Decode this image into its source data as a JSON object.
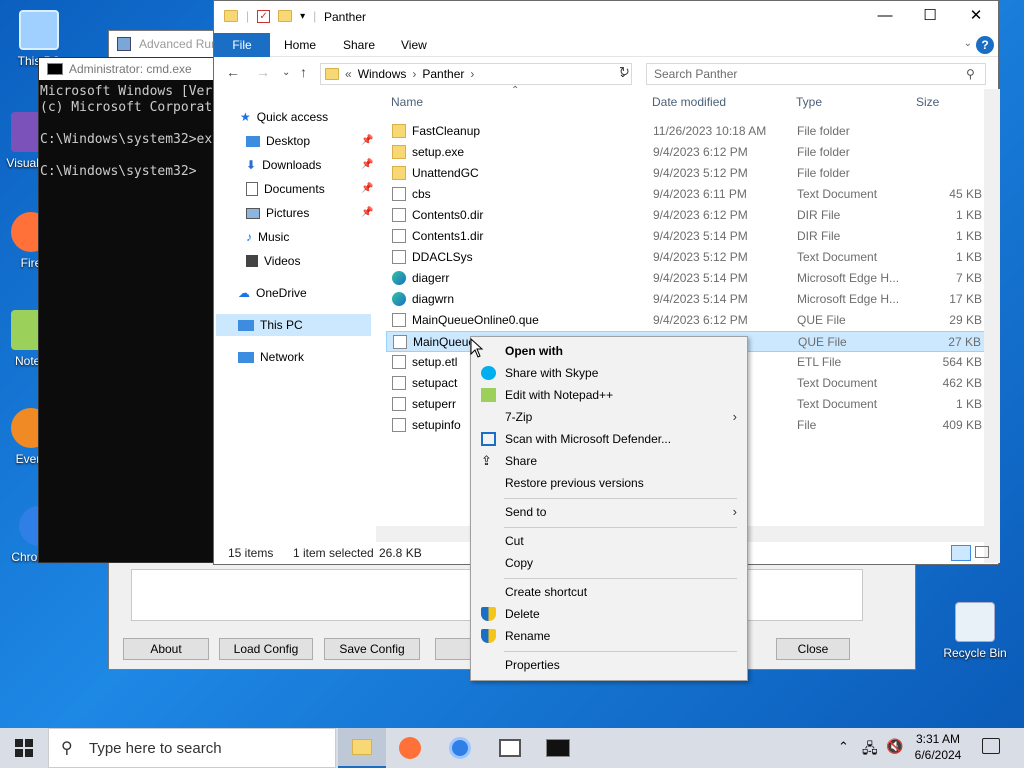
{
  "desktop": {
    "icons": [
      {
        "label": "This PC"
      },
      {
        "label": "Visual 20"
      },
      {
        "label": "Fire"
      },
      {
        "label": "Notep"
      },
      {
        "label": "Every"
      },
      {
        "label": "Chromium"
      }
    ],
    "recycle_bin": "Recycle Bin"
  },
  "advanced_run": {
    "title": "Advanced Run",
    "buttons": {
      "about": "About",
      "load": "Load Config",
      "save": "Save Config",
      "close": "Close"
    }
  },
  "cmd": {
    "title": "Administrator: cmd.exe",
    "lines": [
      "Microsoft Windows [Ver",
      "(c) Microsoft Corporat",
      "",
      "C:\\Windows\\system32>ex",
      "",
      "C:\\Windows\\system32>"
    ]
  },
  "explorer": {
    "title": "Panther",
    "ribbon": {
      "file": "File",
      "home": "Home",
      "share": "Share",
      "view": "View"
    },
    "address": {
      "prefix": "«",
      "path1": "Windows",
      "path2": "Panther"
    },
    "search_placeholder": "Search Panther",
    "nav": {
      "quick_access": "Quick access",
      "desktop": "Desktop",
      "downloads": "Downloads",
      "documents": "Documents",
      "pictures": "Pictures",
      "music": "Music",
      "videos": "Videos",
      "onedrive": "OneDrive",
      "thispc": "This PC",
      "network": "Network"
    },
    "columns": {
      "name": "Name",
      "date": "Date modified",
      "type": "Type",
      "size": "Size"
    },
    "files": [
      {
        "name": "FastCleanup",
        "date": "11/26/2023 10:18 AM",
        "type": "File folder",
        "size": "",
        "icon": "folder"
      },
      {
        "name": "setup.exe",
        "date": "9/4/2023 6:12 PM",
        "type": "File folder",
        "size": "",
        "icon": "folder"
      },
      {
        "name": "UnattendGC",
        "date": "9/4/2023 5:12 PM",
        "type": "File folder",
        "size": "",
        "icon": "folder"
      },
      {
        "name": "cbs",
        "date": "9/4/2023 6:11 PM",
        "type": "Text Document",
        "size": "45 KB",
        "icon": "doc"
      },
      {
        "name": "Contents0.dir",
        "date": "9/4/2023 6:12 PM",
        "type": "DIR File",
        "size": "1 KB",
        "icon": "doc"
      },
      {
        "name": "Contents1.dir",
        "date": "9/4/2023 5:14 PM",
        "type": "DIR File",
        "size": "1 KB",
        "icon": "doc"
      },
      {
        "name": "DDACLSys",
        "date": "9/4/2023 5:12 PM",
        "type": "Text Document",
        "size": "1 KB",
        "icon": "doc"
      },
      {
        "name": "diagerr",
        "date": "9/4/2023 5:14 PM",
        "type": "Microsoft Edge H...",
        "size": "7 KB",
        "icon": "edge"
      },
      {
        "name": "diagwrn",
        "date": "9/4/2023 5:14 PM",
        "type": "Microsoft Edge H...",
        "size": "17 KB",
        "icon": "edge"
      },
      {
        "name": "MainQueueOnline0.que",
        "date": "9/4/2023 6:12 PM",
        "type": "QUE File",
        "size": "29 KB",
        "icon": "doc"
      },
      {
        "name": "MainQueue",
        "date": "",
        "type": "QUE File",
        "size": "27 KB",
        "icon": "doc"
      },
      {
        "name": "setup.etl",
        "date": "",
        "type": "ETL File",
        "size": "564 KB",
        "icon": "doc"
      },
      {
        "name": "setupact",
        "date": "",
        "type": "Text Document",
        "size": "462 KB",
        "icon": "doc"
      },
      {
        "name": "setuperr",
        "date": "",
        "type": "Text Document",
        "size": "1 KB",
        "icon": "doc"
      },
      {
        "name": "setupinfo",
        "date": "",
        "type": "File",
        "size": "409 KB",
        "icon": "doc"
      }
    ],
    "status": {
      "count": "15 items",
      "selected": "1 item selected",
      "size": "26.8 KB"
    }
  },
  "context_menu": {
    "open_with": "Open with",
    "skype": "Share with Skype",
    "notepadpp": "Edit with Notepad++",
    "zip": "7-Zip",
    "defender": "Scan with Microsoft Defender...",
    "share": "Share",
    "restore": "Restore previous versions",
    "send_to": "Send to",
    "cut": "Cut",
    "copy": "Copy",
    "shortcut": "Create shortcut",
    "delete": "Delete",
    "rename": "Rename",
    "properties": "Properties"
  },
  "taskbar": {
    "search_placeholder": "Type here to search",
    "time": "3:31 AM",
    "date": "6/6/2024"
  }
}
